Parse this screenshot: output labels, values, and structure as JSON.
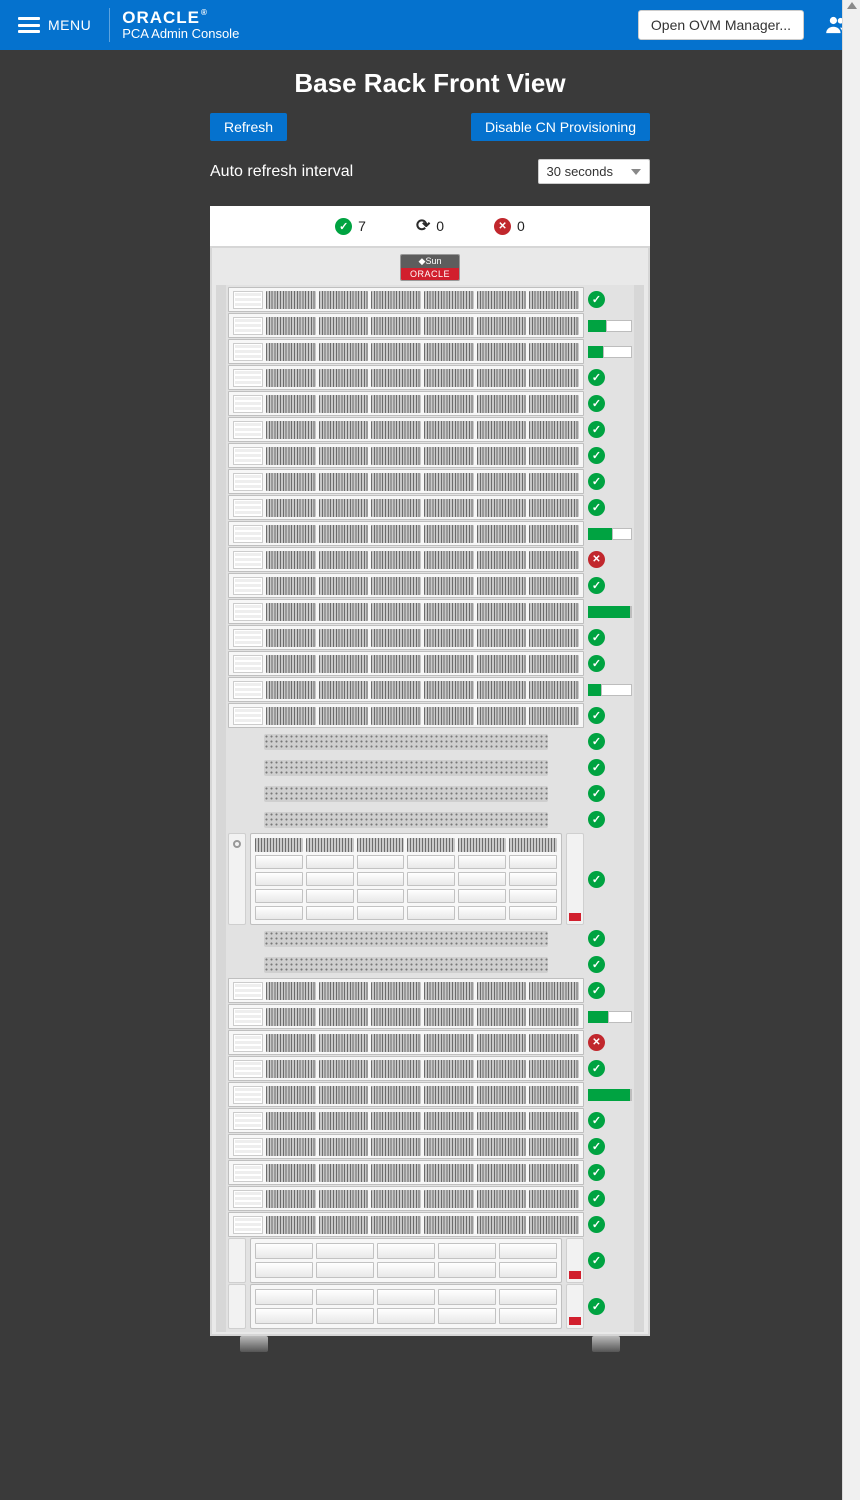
{
  "header": {
    "menu_label": "MENU",
    "brand_top": "ORACLE",
    "brand_sub": "PCA Admin Console",
    "ovm_button": "Open OVM Manager..."
  },
  "page": {
    "title": "Base Rack Front View",
    "refresh_button": "Refresh",
    "disable_button": "Disable CN Provisioning",
    "interval_label": "Auto refresh interval",
    "interval_value": "30 seconds"
  },
  "status": {
    "ok_count": "7",
    "pending_count": "0",
    "error_count": "0"
  },
  "rack_label": {
    "top": "◆Sun",
    "bottom": "ORACLE"
  },
  "rows": [
    {
      "t": "srv",
      "ind": "ok"
    },
    {
      "t": "srv",
      "ind": "bar",
      "g": 40
    },
    {
      "t": "srv",
      "ind": "bar",
      "g": 35
    },
    {
      "t": "srv",
      "ind": "ok"
    },
    {
      "t": "srv",
      "ind": "ok"
    },
    {
      "t": "srv",
      "ind": "ok"
    },
    {
      "t": "srv",
      "ind": "ok"
    },
    {
      "t": "srv",
      "ind": "ok"
    },
    {
      "t": "srv",
      "ind": "ok"
    },
    {
      "t": "srv",
      "ind": "bar",
      "g": 55
    },
    {
      "t": "srv",
      "ind": "err"
    },
    {
      "t": "srv",
      "ind": "ok"
    },
    {
      "t": "srv",
      "ind": "bar",
      "g": 100
    },
    {
      "t": "srv",
      "ind": "ok"
    },
    {
      "t": "srv",
      "ind": "ok"
    },
    {
      "t": "srv",
      "ind": "bar",
      "g": 30
    },
    {
      "t": "srv",
      "ind": "ok"
    },
    {
      "t": "vent",
      "ind": "ok"
    },
    {
      "t": "vent",
      "ind": "ok"
    },
    {
      "t": "vent",
      "ind": "ok"
    },
    {
      "t": "vent",
      "ind": "ok"
    },
    {
      "t": "storage",
      "rows": 4,
      "ind": "ok"
    },
    {
      "t": "vent",
      "ind": "ok"
    },
    {
      "t": "vent",
      "ind": "ok"
    },
    {
      "t": "srv",
      "ind": "ok"
    },
    {
      "t": "srv",
      "ind": "bar",
      "g": 45
    },
    {
      "t": "srv",
      "ind": "err"
    },
    {
      "t": "srv",
      "ind": "ok"
    },
    {
      "t": "srv",
      "ind": "bar",
      "g": 100
    },
    {
      "t": "srv",
      "ind": "ok"
    },
    {
      "t": "srv",
      "ind": "ok"
    },
    {
      "t": "srv",
      "ind": "ok"
    },
    {
      "t": "srv",
      "ind": "ok"
    },
    {
      "t": "srv",
      "ind": "ok"
    },
    {
      "t": "storage2",
      "ind": "ok"
    },
    {
      "t": "storage2",
      "ind": "ok"
    }
  ]
}
